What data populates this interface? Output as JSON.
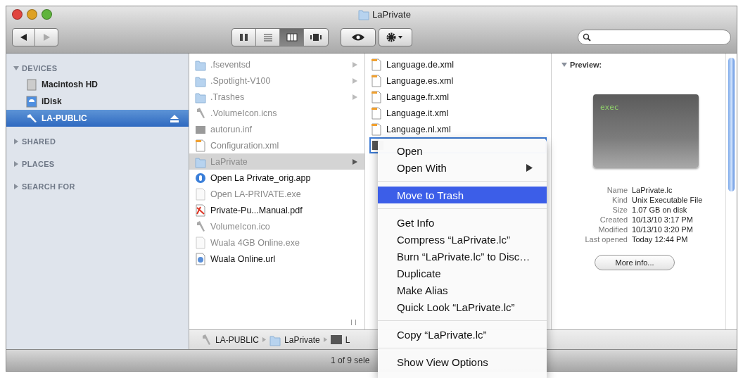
{
  "window": {
    "title": "LaPrivate"
  },
  "toolbar": {
    "nav": [
      {
        "kind": "back",
        "disabled": false
      },
      {
        "kind": "forward",
        "disabled": true
      }
    ],
    "views": [
      {
        "kind": "icons",
        "selected": false
      },
      {
        "kind": "list",
        "selected": false
      },
      {
        "kind": "columns",
        "selected": true
      },
      {
        "kind": "coverflow",
        "selected": false
      }
    ]
  },
  "sidebar": {
    "sections": [
      {
        "label": "DEVICES",
        "expanded": true,
        "items": [
          {
            "name": "Macintosh HD",
            "kind": "disk",
            "selected": false,
            "ejectable": false
          },
          {
            "name": "iDisk",
            "kind": "idisk",
            "selected": false,
            "ejectable": false
          },
          {
            "name": "LA-PUBLIC",
            "kind": "volume",
            "selected": true,
            "ejectable": true
          }
        ]
      },
      {
        "label": "SHARED",
        "expanded": false
      },
      {
        "label": "PLACES",
        "expanded": false
      },
      {
        "label": "SEARCH FOR",
        "expanded": false
      }
    ]
  },
  "column_1": {
    "items": [
      {
        "name": ".fseventsd",
        "kind": "folder",
        "dimmed": true,
        "has_children": true,
        "selected": false
      },
      {
        "name": ".Spotlight-V100",
        "kind": "folder",
        "dimmed": true,
        "has_children": true,
        "selected": false
      },
      {
        "name": ".Trashes",
        "kind": "folder",
        "dimmed": true,
        "has_children": true,
        "selected": false
      },
      {
        "name": ".VolumeIcon.icns",
        "kind": "volume",
        "dimmed": true,
        "has_children": false,
        "selected": false
      },
      {
        "name": "autorun.inf",
        "kind": "plain",
        "dimmed": true,
        "has_children": false,
        "selected": false
      },
      {
        "name": "Configuration.xml",
        "kind": "xml",
        "dimmed": true,
        "has_children": false,
        "selected": false
      },
      {
        "name": "LaPrivate",
        "kind": "folder",
        "dimmed": true,
        "has_children": true,
        "selected": true
      },
      {
        "name": "Open La Private_orig.app",
        "kind": "app",
        "dimmed": false,
        "has_children": false,
        "selected": false
      },
      {
        "name": "Open LA-PRIVATE.exe",
        "kind": "blank",
        "dimmed": true,
        "has_children": false,
        "selected": false
      },
      {
        "name": "Private-Pu...Manual.pdf",
        "kind": "pdf",
        "dimmed": false,
        "has_children": false,
        "selected": false
      },
      {
        "name": "VolumeIcon.ico",
        "kind": "volume",
        "dimmed": true,
        "has_children": false,
        "selected": false
      },
      {
        "name": "Wuala 4GB Online.exe",
        "kind": "blank",
        "dimmed": true,
        "has_children": false,
        "selected": false
      },
      {
        "name": "Wuala Online.url",
        "kind": "url",
        "dimmed": false,
        "has_children": false,
        "selected": false
      }
    ]
  },
  "column_2": {
    "items": [
      {
        "name": "Language.de.xml",
        "kind": "xml",
        "selected": false
      },
      {
        "name": "Language.es.xml",
        "kind": "xml",
        "selected": false
      },
      {
        "name": "Language.fr.xml",
        "kind": "xml",
        "selected": false
      },
      {
        "name": "Language.it.xml",
        "kind": "xml",
        "selected": false
      },
      {
        "name": "Language.nl.xml",
        "kind": "xml",
        "selected": false
      },
      {
        "kind": "exec",
        "selected": true
      }
    ]
  },
  "preview": {
    "heading": "Preview:",
    "expanded": true,
    "thumbnail_label": "exec",
    "info": [
      {
        "label": "Name",
        "value": "LaPrivate.lc"
      },
      {
        "label": "Kind",
        "value": "Unix Executable File"
      },
      {
        "label": "Size",
        "value": "1.07 GB on disk"
      },
      {
        "label": "Created",
        "value": "10/13/10 3:17 PM"
      },
      {
        "label": "Modified",
        "value": "10/13/10 3:20 PM"
      },
      {
        "label": "Last opened",
        "value": "Today 12:44 PM"
      }
    ],
    "button": "More info..."
  },
  "path_bar": [
    {
      "name": "LA-PUBLIC",
      "kind": "volume"
    },
    {
      "name": "LaPrivate",
      "kind": "folder"
    },
    {
      "name": "L",
      "kind": "exec"
    }
  ],
  "status_bar": {
    "text": "1 of 9 sele"
  },
  "context_menu": {
    "groups": [
      [
        {
          "label": "Open",
          "submenu": false,
          "selected": false
        },
        {
          "label": "Open With",
          "submenu": true,
          "selected": false
        }
      ],
      [
        {
          "label": "Move to Trash",
          "submenu": false,
          "selected": true
        }
      ],
      [
        {
          "label": "Get Info",
          "submenu": false,
          "selected": false
        },
        {
          "label": "Compress “LaPrivate.lc”",
          "submenu": false,
          "selected": false
        },
        {
          "label": "Burn “LaPrivate.lc” to Disc…",
          "submenu": false,
          "selected": false
        },
        {
          "label": "Duplicate",
          "submenu": false,
          "selected": false
        },
        {
          "label": "Make Alias",
          "submenu": false,
          "selected": false
        },
        {
          "label": "Quick Look “LaPrivate.lc”",
          "submenu": false,
          "selected": false
        }
      ],
      [
        {
          "label": "Copy “LaPrivate.lc”",
          "submenu": false,
          "selected": false
        }
      ],
      [
        {
          "label": "Show View Options",
          "submenu": false,
          "selected": false
        }
      ]
    ]
  }
}
